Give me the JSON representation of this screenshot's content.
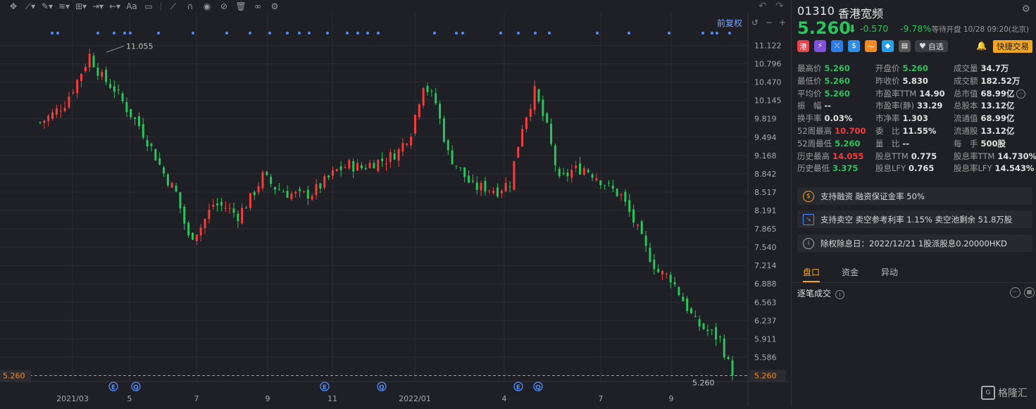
{
  "toolbar": {
    "icons": [
      "crosshair-icon",
      "line-tool-icon",
      "pencil-tool-icon",
      "fib-tool-icon",
      "pattern-tool-icon",
      "measure-tool-icon",
      "arrow-tool-icon",
      "text-tool-icon",
      "comment-icon",
      "ruler-icon",
      "magnet-icon",
      "eye-icon",
      "hide-icon",
      "trash-icon",
      "link-icon",
      "gear-icon"
    ],
    "text_label": "Aa",
    "undo": "undo-icon",
    "redo": "redo-icon"
  },
  "chart_controls": {
    "adjust_label": "前复权",
    "zoom_out": "−",
    "zoom_in": "+"
  },
  "chart_data": {
    "type": "candlestick",
    "title": "",
    "y_ticks": [
      "11.122",
      "10.796",
      "10.470",
      "10.145",
      "9.819",
      "9.494",
      "9.168",
      "8.842",
      "8.517",
      "8.191",
      "7.865",
      "7.540",
      "7.214",
      "6.888",
      "6.563",
      "6.237",
      "5.911",
      "5.586"
    ],
    "ylim": [
      5.26,
      11.122
    ],
    "x_ticks": [
      "2021/03",
      "5",
      "7",
      "9",
      "11",
      "2022/01",
      "4",
      "7",
      "9"
    ],
    "current_price": "5.260",
    "high_annotation": "11.055",
    "low_annotation": "5.260",
    "event_markers": [
      "E",
      "Q",
      "E",
      "Q",
      "E",
      "Q"
    ],
    "close_path": [
      [
        0,
        9.75
      ],
      [
        3,
        9.9
      ],
      [
        6,
        10.1
      ],
      [
        9,
        10.5
      ],
      [
        12,
        10.95
      ],
      [
        15,
        10.55
      ],
      [
        18,
        10.35
      ],
      [
        21,
        10.0
      ],
      [
        24,
        9.7
      ],
      [
        27,
        9.3
      ],
      [
        30,
        8.85
      ],
      [
        33,
        8.5
      ],
      [
        36,
        7.7
      ],
      [
        39,
        7.9
      ],
      [
        42,
        8.3
      ],
      [
        45,
        8.25
      ],
      [
        48,
        8.1
      ],
      [
        51,
        8.4
      ],
      [
        54,
        8.8
      ],
      [
        57,
        8.6
      ],
      [
        60,
        8.5
      ],
      [
        63,
        8.45
      ],
      [
        66,
        8.5
      ],
      [
        69,
        8.7
      ],
      [
        72,
        8.9
      ],
      [
        75,
        9.0
      ],
      [
        78,
        8.95
      ],
      [
        81,
        9.05
      ],
      [
        84,
        9.1
      ],
      [
        87,
        9.25
      ],
      [
        90,
        9.6
      ],
      [
        93,
        10.45
      ],
      [
        96,
        10.1
      ],
      [
        99,
        9.2
      ],
      [
        102,
        8.9
      ],
      [
        105,
        8.6
      ],
      [
        108,
        8.6
      ],
      [
        111,
        8.55
      ],
      [
        114,
        8.7
      ],
      [
        117,
        9.7
      ],
      [
        120,
        10.3
      ],
      [
        123,
        9.65
      ],
      [
        126,
        8.7
      ],
      [
        129,
        8.9
      ],
      [
        132,
        8.95
      ],
      [
        135,
        8.8
      ],
      [
        138,
        8.6
      ],
      [
        141,
        8.45
      ],
      [
        144,
        8.0
      ],
      [
        147,
        7.5
      ],
      [
        150,
        7.1
      ],
      [
        153,
        7.0
      ],
      [
        156,
        6.6
      ],
      [
        159,
        6.2
      ],
      [
        162,
        6.05
      ],
      [
        165,
        5.9
      ],
      [
        168,
        5.26
      ]
    ]
  },
  "quote": {
    "code": "01310",
    "name": "香港宽频",
    "price": "5.260",
    "arrow": "⬇",
    "change": "-0.570",
    "change_pct": "-9.78%",
    "status": "等待开盘 10/28 09:20(北京)",
    "fav_label": "自选",
    "trade_label": "快捷交易"
  },
  "stats": [
    [
      {
        "l": "最高价",
        "v": "5.260",
        "c": "green"
      },
      {
        "l": "开盘价",
        "v": "5.260",
        "c": "green"
      },
      {
        "l": "成交量",
        "v": "34.7万",
        "c": ""
      }
    ],
    [
      {
        "l": "最低价",
        "v": "5.260",
        "c": "green"
      },
      {
        "l": "昨收价",
        "v": "5.830",
        "c": ""
      },
      {
        "l": "成交额",
        "v": "182.52万",
        "c": ""
      }
    ],
    [
      {
        "l": "平均价",
        "v": "5.260",
        "c": "green"
      },
      {
        "l": "市盈率TTM",
        "v": "14.90",
        "c": ""
      },
      {
        "l": "总市值",
        "v": "68.99亿",
        "c": ""
      }
    ],
    [
      {
        "l": "振　幅",
        "v": "--",
        "c": ""
      },
      {
        "l": "市盈率(静)",
        "v": "33.29",
        "c": ""
      },
      {
        "l": "总股本",
        "v": "13.12亿",
        "c": ""
      }
    ],
    [
      {
        "l": "换手率",
        "v": "0.03%",
        "c": ""
      },
      {
        "l": "市净率",
        "v": "1.303",
        "c": ""
      },
      {
        "l": "流通值",
        "v": "68.99亿",
        "c": ""
      }
    ],
    [
      {
        "l": "52周最高",
        "v": "10.700",
        "c": "red"
      },
      {
        "l": "委　比",
        "v": "11.55%",
        "c": ""
      },
      {
        "l": "流通股",
        "v": "13.12亿",
        "c": ""
      }
    ],
    [
      {
        "l": "52周最低",
        "v": "5.260",
        "c": "green"
      },
      {
        "l": "量　比",
        "v": "--",
        "c": ""
      },
      {
        "l": "每　手",
        "v": "500股",
        "c": ""
      }
    ],
    [
      {
        "l": "历史最高",
        "v": "14.055",
        "c": "red"
      },
      {
        "l": "股息TTM",
        "v": "0.775",
        "c": ""
      },
      {
        "l": "股息率TTM",
        "v": "14.730%",
        "c": ""
      }
    ],
    [
      {
        "l": "历史最低",
        "v": "3.375",
        "c": "green"
      },
      {
        "l": "股息LFY",
        "v": "0.765",
        "c": ""
      },
      {
        "l": "股息率LFY",
        "v": "14.543%",
        "c": ""
      }
    ]
  ],
  "info": {
    "margin": "支持融资  融资保证金率 50%",
    "short": "支持卖空  卖空参考利率 1.15%  卖空池剩余 51.8万股",
    "dividend": "除权除息日：2022/12/21   1股派股息0.20000HKD"
  },
  "tabs": [
    "盘口",
    "资金",
    "异动"
  ],
  "trades_label": "逐笔成交",
  "logo_text": "格隆汇",
  "colors": {
    "up": "#f23d3d",
    "down": "#29c45a",
    "accent": "#f4a623",
    "blue": "#4d8dff",
    "bg": "#1e2025"
  }
}
